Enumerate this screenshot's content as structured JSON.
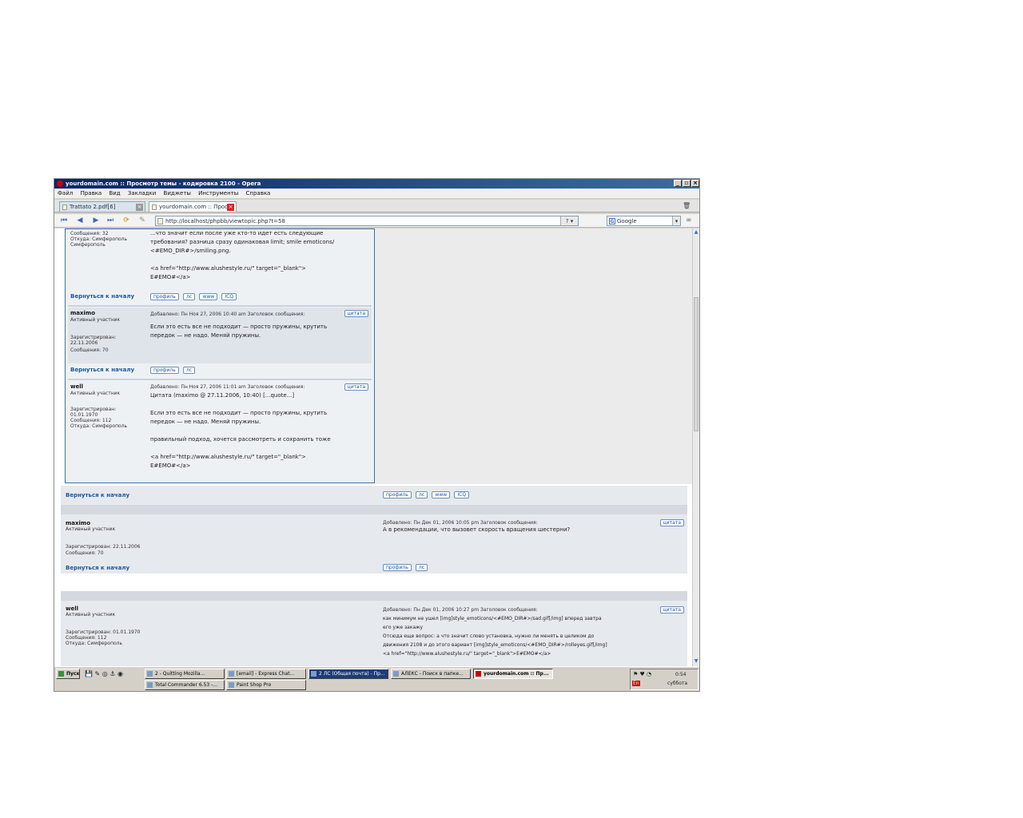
{
  "window": {
    "title": "yourdomain.com :: Просмотр темы - кодировка 2100 - Opera",
    "controls": [
      "_",
      "▫",
      "×"
    ]
  },
  "menu": [
    "Файл",
    "Правка",
    "Вид",
    "Закладки",
    "Виджеты",
    "Инструменты",
    "Справка"
  ],
  "tabs": [
    {
      "label": "Trattato 2.pdf[6]"
    },
    {
      "label": "yourdomain.com :: Прос..."
    }
  ],
  "address": {
    "url": "http://localhost/phpbb/viewtopic.php?t=58",
    "go": "?"
  },
  "search": {
    "engine_icon": "G",
    "placeholder": "Google"
  },
  "inner_posts": [
    {
      "meta_lines": [
        "Сообщения: 32",
        "Откуда: Симферополь",
        "Симферополь"
      ],
      "body": [
        "...что значит если после уже кто-то идет есть следующие",
        "требования? разница сразу одинаковая limit; smile emoticons/",
        "<#EMO_DIR#>/smiling.png.",
        "",
        "<a href=\"http://www.alushestyle.ru/\" target=\"_blank\">",
        "E#EMO#</a>"
      ],
      "back": "Вернуться к началу",
      "buttons": [
        "профиль",
        "лс",
        "www",
        "ICQ"
      ]
    },
    {
      "user": "maximo",
      "rank": "Активный участник",
      "joined": "Зарегистрирован: 22.11.2006",
      "count": "Сообщения: 70",
      "meta": "Добавлено: Пн Ноя 27, 2006 10:40 am    Заголовок сообщения:",
      "quote": "цитата",
      "body": [
        "Если это есть все не подходит — просто пружины, крутить",
        "передок — не надо. Меняй пружины."
      ],
      "back": "Вернуться к началу",
      "buttons": [
        "профиль",
        "лс"
      ]
    },
    {
      "user": "well",
      "rank": "Активный участник",
      "joined": "Зарегистрирован: 01.01.1970",
      "count": "Сообщения: 112",
      "from": "Откуда: Симферополь",
      "meta": "Добавлено: Пн Ноя 27, 2006 11:01 am    Заголовок сообщения:",
      "quote": "цитата",
      "body": [
        "Цитата (maximo @ 27.11.2006, 10:40) [...quote...]",
        "",
        "Если это есть все не подходит — просто пружины, крутить",
        "передок — не надо. Меняй пружины.",
        "",
        "правильный подход, хочется рассмотреть и сохранить тоже",
        "",
        "<a href=\"http://www.alushestyle.ru/\" target=\"_blank\">",
        "E#EMO#</a>"
      ]
    }
  ],
  "outer_rows": [
    {
      "back": "Вернуться к началу",
      "buttons": [
        "профиль",
        "лс",
        "www",
        "ICQ"
      ]
    },
    {
      "user": "maximo",
      "rank": "Активный участник",
      "joined": "Зарегистрирован: 22.11.2006",
      "count": "Сообщения: 70",
      "meta": "Добавлено: Пн Дек 01, 2006 10:05 pm    Заголовок сообщения:",
      "quote": "цитата",
      "body": [
        "А в рекомендации, что вызовет скорость вращения шестерни?"
      ],
      "back": "Вернуться к началу",
      "buttons": [
        "профиль",
        "лс"
      ]
    },
    {
      "user": "well",
      "rank": "Активный участник",
      "joined": "Зарегистрирован: 01.01.1970",
      "count": "Сообщения: 112",
      "from": "Откуда: Симферополь",
      "meta": "Добавлено: Пн Дек 01, 2006 10:27 pm    Заголовок сообщения:",
      "quote": "цитата",
      "body": [
        "как минимум не ушел [img]style_emoticons/<#EMO_DIR#>/sad.gif[/img] вперед завтра",
        "его уже закажу",
        "Отсюда еще вопрос: а что значит слово установка, нужно ли менять в целиком до",
        "движения 2108 и до этого вариант [img]style_emoticons/<#EMO_DIR#>/rolleyes.gif[/img]",
        "<a href=\"http://www.alushestyle.ru/\" target=\"_blank\">E#EMO#</a>"
      ]
    }
  ],
  "taskbar": {
    "start": "Пуск",
    "items": [
      "2 - Quitting Mozilla...",
      "[email] - Express Chat...",
      "2 ЛС (Общая почта) - Пр...",
      "АЛЕКС - Поиск в папке...",
      "yourdomain.com :: Пр...",
      "Total Commander 6.53 -...",
      "Paint Shop Pro"
    ],
    "tray_lang": "En",
    "tray_time": "0:54",
    "tray_day": "суббота"
  },
  "colors": {
    "title_start": "#0a246a",
    "title_end": "#3a6ea5",
    "link": "#1c58a0",
    "frame": "#3b6fa6"
  }
}
